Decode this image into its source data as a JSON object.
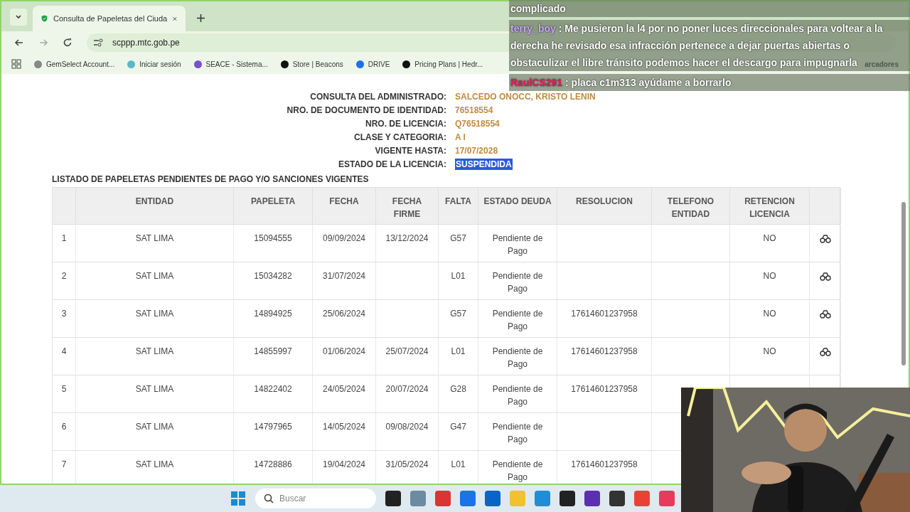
{
  "browser": {
    "tab_title": "Consulta de Papeletas del Ciuda",
    "address": "scppp.mtc.gob.pe",
    "bookmarks": [
      "GemSelect Account...",
      "Iniciar sesión",
      "SEACE - Sistema...",
      "Store | Beacons",
      "DRIVE",
      "Pricing Plans | Hedr..."
    ],
    "bookmarks_folder": "arcadores"
  },
  "license": {
    "fields": [
      {
        "label": "CONSULTA DEL ADMINISTRADO:",
        "value": "SALCEDO ONOCC, KRISTO LENIN",
        "highlighted": false
      },
      {
        "label": "NRO. DE DOCUMENTO DE IDENTIDAD:",
        "value": "76518554",
        "highlighted": false
      },
      {
        "label": "NRO. DE LICENCIA:",
        "value": "Q76518554",
        "highlighted": false
      },
      {
        "label": "CLASE Y CATEGORIA:",
        "value": "A I",
        "highlighted": false
      },
      {
        "label": "VIGENTE HASTA:",
        "value": "17/07/2028",
        "highlighted": false
      },
      {
        "label": "ESTADO DE LA LICENCIA:",
        "value": "SUSPENDIDA",
        "highlighted": true
      }
    ]
  },
  "list_title": "LISTADO DE PAPELETAS PENDIENTES DE PAGO Y/O SANCIONES VIGENTES",
  "table": {
    "columns": [
      "",
      "ENTIDAD",
      "PAPELETA",
      "FECHA",
      "FECHA FIRME",
      "FALTA",
      "ESTADO DEUDA",
      "RESOLUCION",
      "TELEFONO ENTIDAD",
      "RETENCION LICENCIA",
      ""
    ],
    "rows": [
      {
        "cells": [
          "1",
          "SAT LIMA",
          "15094555",
          "09/09/2024",
          "13/12/2024",
          "G57",
          "Pendiente de Pago",
          "",
          "",
          "NO"
        ],
        "action_icon": true
      },
      {
        "cells": [
          "2",
          "SAT LIMA",
          "15034282",
          "31/07/2024",
          "",
          "L01",
          "Pendiente de Pago",
          "",
          "",
          "NO"
        ],
        "action_icon": true
      },
      {
        "cells": [
          "3",
          "SAT LIMA",
          "14894925",
          "25/06/2024",
          "",
          "G57",
          "Pendiente de Pago",
          "17614601237958",
          "",
          "NO"
        ],
        "action_icon": true
      },
      {
        "cells": [
          "4",
          "SAT LIMA",
          "14855997",
          "01/06/2024",
          "25/07/2024",
          "L01",
          "Pendiente de Pago",
          "17614601237958",
          "",
          "NO"
        ],
        "action_icon": true
      },
      {
        "cells": [
          "5",
          "SAT LIMA",
          "14822402",
          "24/05/2024",
          "20/07/2024",
          "G28",
          "Pendiente de Pago",
          "17614601237958"
        ]
      },
      {
        "cells": [
          "6",
          "SAT LIMA",
          "14797965",
          "14/05/2024",
          "09/08/2024",
          "G47",
          "Pendiente de Pago",
          ""
        ]
      },
      {
        "cells": [
          "7",
          "SAT LIMA",
          "14728886",
          "19/04/2024",
          "31/05/2024",
          "L01",
          "Pendiente de Pago",
          "17614601237958"
        ]
      }
    ]
  },
  "chat": {
    "messages": [
      {
        "text": "complicado"
      },
      {
        "user": "terry_boy",
        "separator": ":",
        "text": "Me pusieron la l4 por no poner luces direccionales para voltear a la derecha he revisado esa infracción pertenece a dejar puertas abiertas o obstaculizar el libre tránsito podemos hacer el descargo para impugnarla",
        "color": "#c9a8ff"
      },
      {
        "user": "RaulCS291",
        "separator": ":",
        "text": "placa c1m313 ayúdame a borrarlo",
        "color": "#e0245e"
      }
    ]
  },
  "taskbar": {
    "search_placeholder": "Buscar"
  }
}
